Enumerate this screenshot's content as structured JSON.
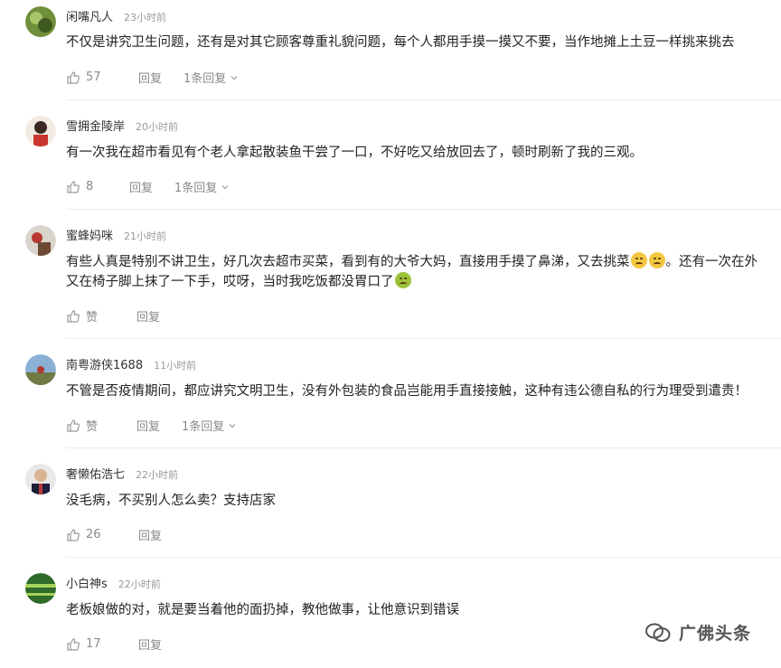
{
  "comments": [
    {
      "username": "闲嘴凡人",
      "time": "23小时前",
      "text": "不仅是讲究卫生问题，还有是对其它顾客尊重礼貌问题，每个人都用手摸一摸又不要，当作地摊上土豆一样挑来挑去",
      "likes": "57",
      "reply_label": "回复",
      "replies_label": "1条回复"
    },
    {
      "username": "雪拥金陵岸",
      "time": "20小时前",
      "text": "有一次我在超市看见有个老人拿起散装鱼干尝了一口，不好吃又给放回去了，顿时刷新了我的三观。",
      "likes": "8",
      "reply_label": "回复",
      "replies_label": "1条回复"
    },
    {
      "username": "蜜蜂妈咪",
      "time": "21小时前",
      "text_line1": "有些人真是特别不讲卫生，好几次去超市买菜，看到有的大爷大妈，直接用手摸了鼻涕，又去挑菜",
      "text_line1_tail": "。还有一次在外",
      "text_line2": "又在椅子脚上抹了一下手，哎呀，当时我吃饭都没胃口了",
      "likes": "赞",
      "reply_label": "回复"
    },
    {
      "username": "南粤游侠1688",
      "time": "11小时前",
      "text": "不管是否疫情期间，都应讲究文明卫生，没有外包装的食品岂能用手直接接触，这种有违公德自私的行为理受到遣责！",
      "likes": "赞",
      "reply_label": "回复",
      "replies_label": "1条回复"
    },
    {
      "username": "奢懒佑浩七",
      "time": "22小时前",
      "text": "没毛病，不买别人怎么卖？支持店家",
      "likes": "26",
      "reply_label": "回复"
    },
    {
      "username": "小白神s",
      "time": "22小时前",
      "text": "老板娘做的对，就是要当着他的面扔掉，教他做事，让他意识到错误",
      "likes": "17",
      "reply_label": "回复"
    }
  ],
  "watermark": {
    "text": "广佛头条"
  },
  "colors": {
    "meta": "#9a9a9a",
    "action": "#8a8a8a",
    "divider": "#ececec"
  }
}
